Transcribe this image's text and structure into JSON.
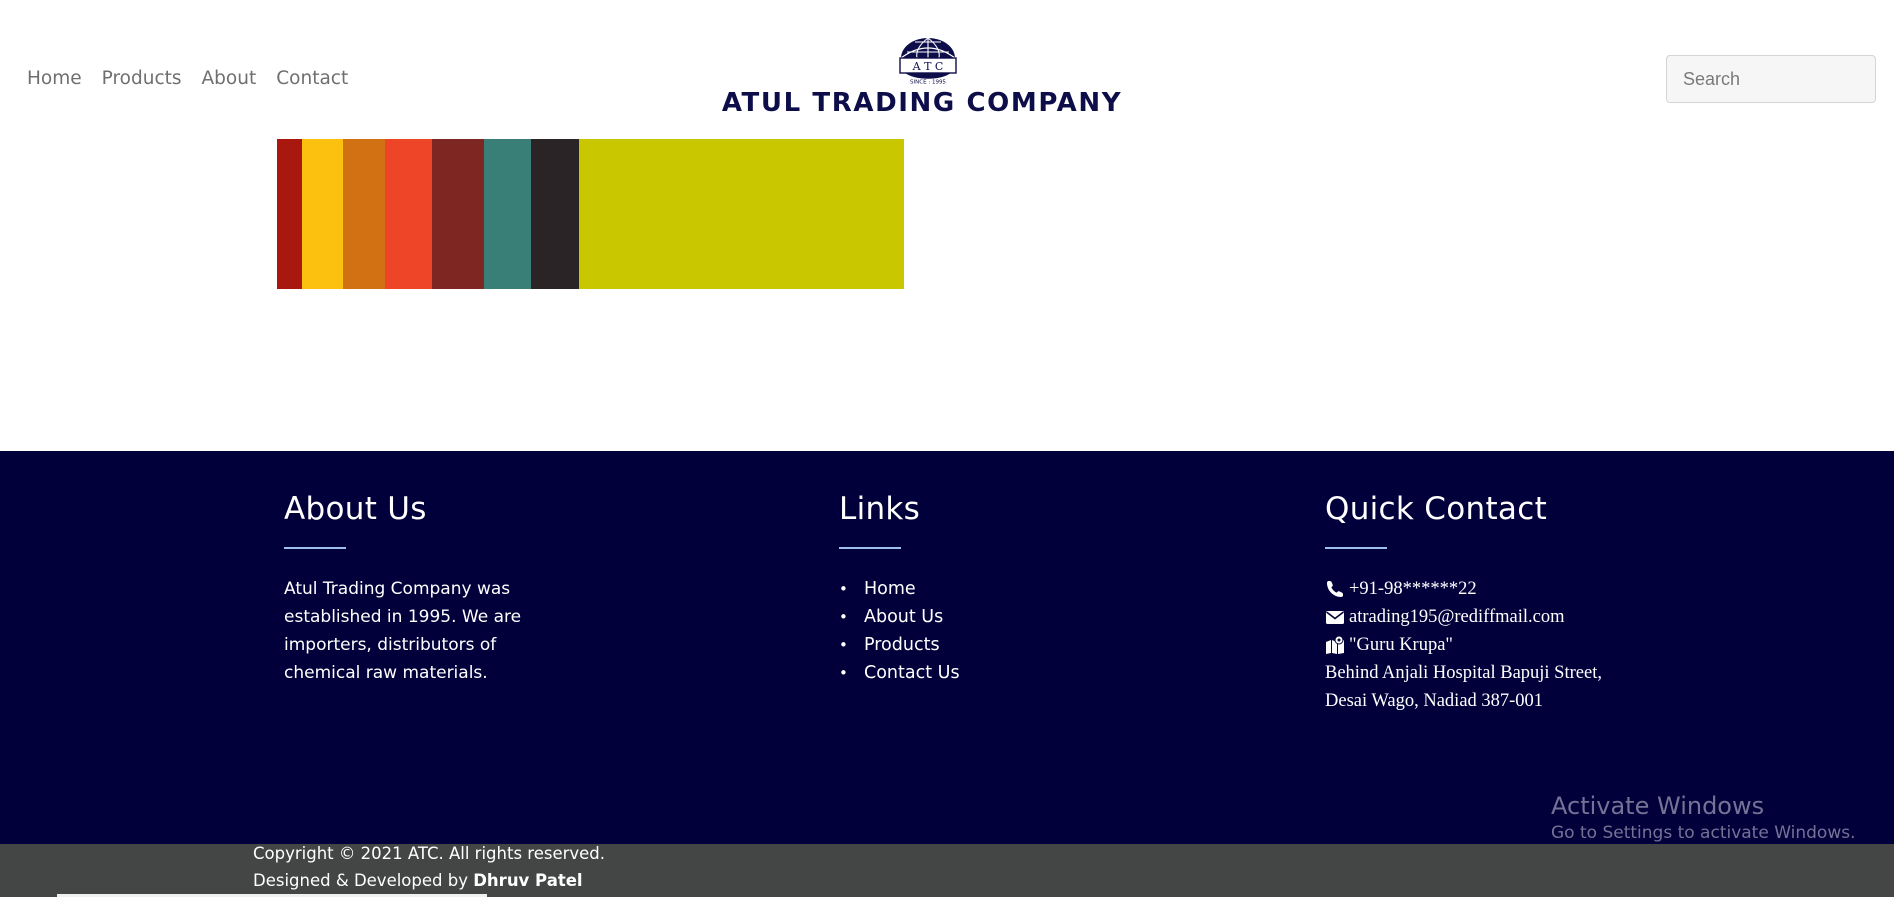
{
  "nav": {
    "items": [
      "Home",
      "Products",
      "About",
      "Contact"
    ]
  },
  "logo": {
    "emblem_text": "A T C",
    "since": "SINCE : 1995",
    "name": "ATUL TRADING COMPANY"
  },
  "search": {
    "placeholder": "Search"
  },
  "hero": {
    "stripe_colors": [
      "#a8180f",
      "#fcc10e",
      "#d27113",
      "#ee4428",
      "#7d2622",
      "#3a7e78",
      "#2b2427",
      "#c8c700"
    ]
  },
  "footer": {
    "about": {
      "title": "About Us",
      "text": "Atul Trading Company was established in 1995. We are importers, distributors of chemical raw materials."
    },
    "links": {
      "title": "Links",
      "items": [
        "Home",
        "About Us",
        "Products",
        "Contact Us"
      ]
    },
    "contact": {
      "title": "Quick Contact",
      "phone": "+91-98******22",
      "email": "atrading195@rediffmail.com",
      "address_name": "\"Guru Krupa\"",
      "address_line1": "Behind Anjali Hospital Bapuji Street,",
      "address_line2": "Desai Wago, Nadiad 387-001"
    },
    "copyright": "Copyright © 2021 ATC. All rights reserved.",
    "designed_by": "Designed & Developed by",
    "developer": "Dhruv Patel"
  },
  "watermark": {
    "title": "Activate Windows",
    "subtitle": "Go to Settings to activate Windows."
  },
  "colors": {
    "footer_bg": "#01003a",
    "bottom_bar_bg": "#444545",
    "accent_underline": "#9fc0ef",
    "brand_navy": "#0d0d4a"
  },
  "icons": {
    "phone": "phone-icon",
    "email": "envelope-icon",
    "address": "map-marker-icon"
  }
}
